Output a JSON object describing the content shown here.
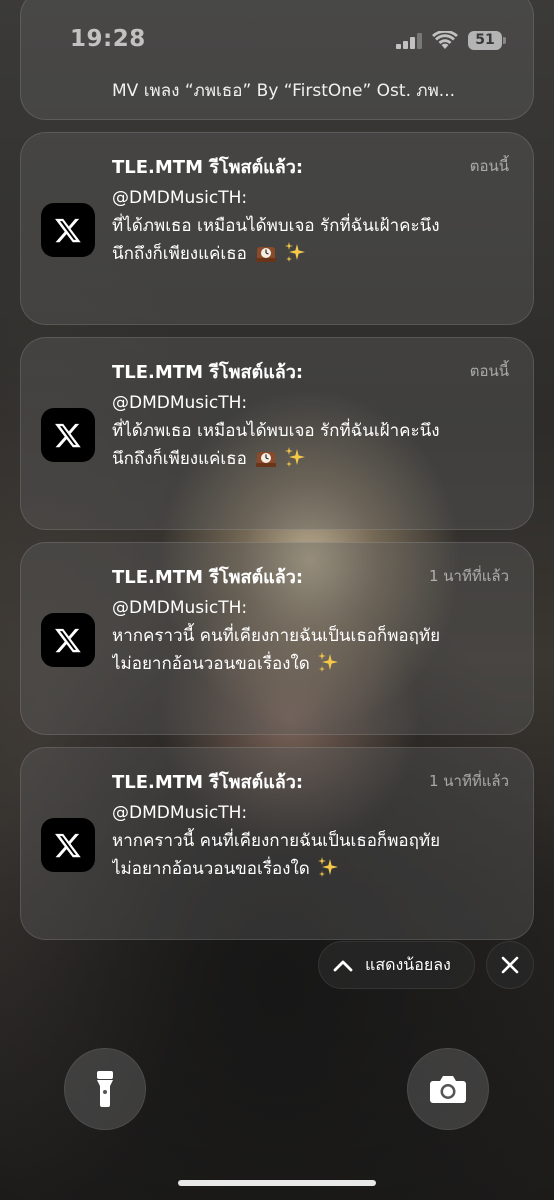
{
  "status_bar": {
    "time": "19:28",
    "battery": "51"
  },
  "top_card": {
    "text": "MV เพลง “ภพเธอ” By “FirstOne” Ost. ภพ..."
  },
  "notifications": [
    {
      "app_icon": "x-logo-icon",
      "title": "TLE.MTM รีโพสต์แล้ว:",
      "time": "ตอนนี้",
      "handle": "@DMDMusicTH:",
      "line1": "ที่ได้ภพเธอ เหมือนได้พบเจอ รักที่ฉันเฝ้าคะนึง",
      "line2": "นึกถึงก็เพียงแค่เธอ",
      "emojis": [
        "mantelpiece-clock-emoji",
        "sparkles-emoji"
      ]
    },
    {
      "app_icon": "x-logo-icon",
      "title": "TLE.MTM รีโพสต์แล้ว:",
      "time": "ตอนนี้",
      "handle": "@DMDMusicTH:",
      "line1": "ที่ได้ภพเธอ เหมือนได้พบเจอ รักที่ฉันเฝ้าคะนึง",
      "line2": "นึกถึงก็เพียงแค่เธอ",
      "emojis": [
        "mantelpiece-clock-emoji",
        "sparkles-emoji"
      ]
    },
    {
      "app_icon": "x-logo-icon",
      "title": "TLE.MTM รีโพสต์แล้ว:",
      "time": "1 นาทีที่แล้ว",
      "handle": "@DMDMusicTH:",
      "line1": "หากคราวนี้ คนที่เคียงกายฉันเป็นเธอก็พอฤทัย",
      "line2": "ไม่อยากอ้อนวอนขอเรื่องใด",
      "emojis": [
        "sparkles-emoji"
      ]
    },
    {
      "app_icon": "x-logo-icon",
      "title": "TLE.MTM รีโพสต์แล้ว:",
      "time": "1 นาทีที่แล้ว",
      "handle": "@DMDMusicTH:",
      "line1": "หากคราวนี้ คนที่เคียงกายฉันเป็นเธอก็พอฤทัย",
      "line2": "ไม่อยากอ้อนวอนขอเรื่องใด",
      "emojis": [
        "sparkles-emoji"
      ]
    }
  ],
  "controls": {
    "show_less_label": "แสดงน้อยลง",
    "show_less_icon": "chevron-up-icon",
    "close_icon": "close-icon",
    "flashlight_icon": "flashlight-icon",
    "camera_icon": "camera-icon"
  }
}
